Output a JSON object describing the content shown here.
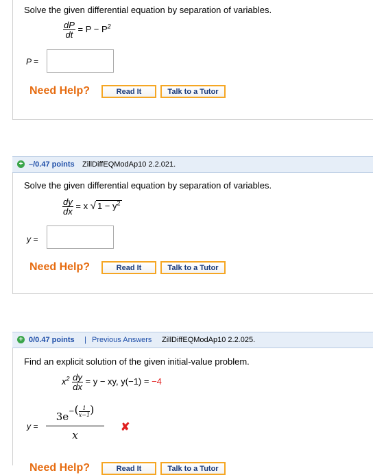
{
  "problem1": {
    "prompt": "Solve the given differential equation by separation of variables.",
    "eq_num": "dP",
    "eq_den": "dt",
    "eq_rhs": "= P − P",
    "eq_rhs_sup": "2",
    "answer_label": "P =",
    "answer_value": ""
  },
  "problem2": {
    "points": "–/0.47 points",
    "code": "ZillDiffEQModAp10 2.2.021.",
    "prompt": "Solve the given differential equation by separation of variables.",
    "eq_num": "dy",
    "eq_den": "dx",
    "eq_rhs_pre": "= x",
    "eq_rhs_root": "1 − y",
    "eq_rhs_sup": "2",
    "answer_label": "y =",
    "answer_value": ""
  },
  "problem3": {
    "points": "0/0.47 points",
    "separator": "|",
    "previous_answers": "Previous Answers",
    "code": "ZillDiffEQModAp10 2.2.025.",
    "prompt": "Find an explicit solution of the given initial-value problem.",
    "eq_lhs": "x",
    "eq_lhs_sup": "2",
    "eq_num": "dy",
    "eq_den": "dx",
    "eq_rhs": "= y − xy,  y(−1) = ",
    "eq_ic_value": "−4",
    "answer_label": "y =",
    "answer_coef": "3e",
    "answer_exp_minus": "−",
    "answer_exp_num": "1",
    "answer_exp_den": "x−1",
    "answer_den": "x",
    "result": "incorrect"
  },
  "help": {
    "label": "Need Help?",
    "read_it": "Read It",
    "talk_tutor": "Talk to a Tutor"
  },
  "colors": {
    "help_orange": "#e66b0f",
    "button_border": "#f5a623",
    "link_blue": "#1e4ea8",
    "header_bg": "#e6eef8",
    "ic_red": "#e02020"
  }
}
